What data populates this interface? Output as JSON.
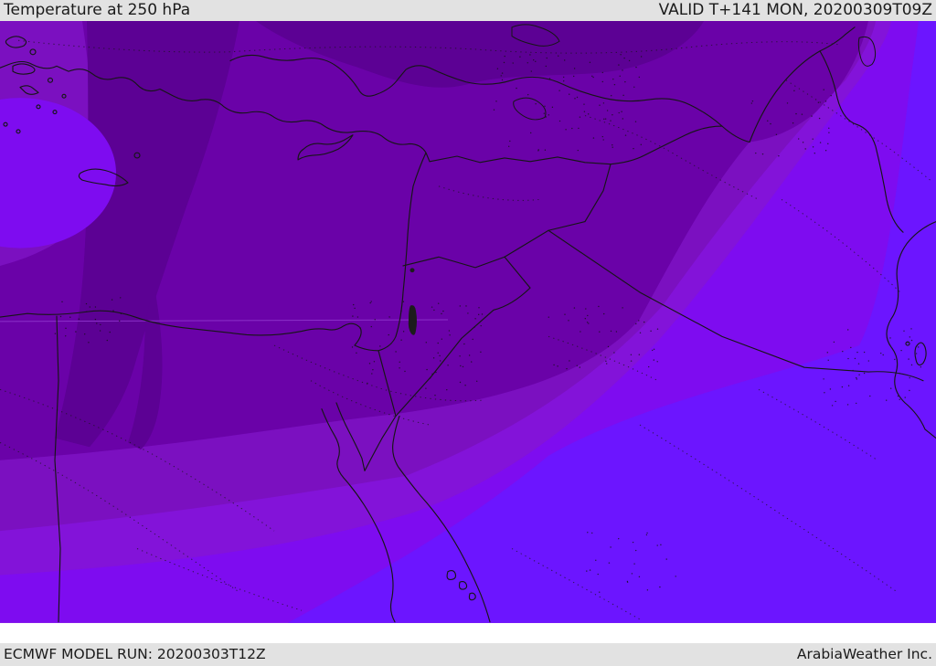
{
  "header": {
    "title": "Temperature at 250 hPa",
    "valid": "VALID T+141 MON, 20200309T09Z"
  },
  "footer": {
    "model_run": "ECMWF MODEL RUN: 20200303T12Z",
    "brand": "ArabiaWeather Inc."
  },
  "colors": {
    "bar_bg": "#e2e2e2",
    "bar_text": "#1b1b1b",
    "coastline": "#161616",
    "graticule": "#8f35cc"
  },
  "map": {
    "parameter": "Temperature",
    "level": "250 hPa",
    "palette": {
      "t1": "#5c0194",
      "t2": "#6a02a8",
      "t3": "#7b10c0",
      "t4": "#8313d9",
      "t5": "#7e0cf0",
      "t6": "#6c15ff"
    },
    "band_order_cold_to_warm": [
      "t1",
      "t2",
      "t3",
      "t4",
      "t5",
      "t6"
    ]
  }
}
